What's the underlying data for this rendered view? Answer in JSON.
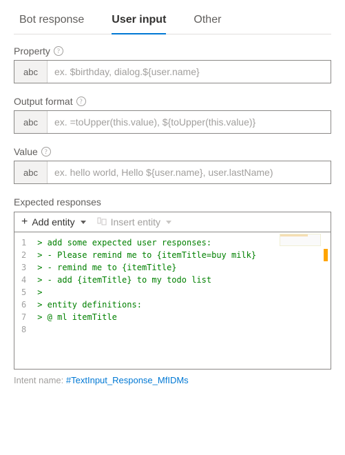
{
  "tabs": {
    "bot_response": "Bot response",
    "user_input": "User input",
    "other": "Other"
  },
  "fields": {
    "property": {
      "label": "Property",
      "prefix": "abc",
      "placeholder": "ex. $birthday, dialog.${user.name}"
    },
    "output_format": {
      "label": "Output format",
      "prefix": "abc",
      "placeholder": "ex. =toUpper(this.value), ${toUpper(this.value)}"
    },
    "value": {
      "label": "Value",
      "prefix": "abc",
      "placeholder": "ex. hello world, Hello ${user.name}, user.lastName)"
    }
  },
  "expected": {
    "label": "Expected responses",
    "add_entity": "Add entity",
    "insert_entity": "Insert entity",
    "lines": [
      "> add some expected user responses:",
      "> - Please remind me to {itemTitle=buy milk}",
      "> - remind me to {itemTitle}",
      "> - add {itemTitle} to my todo list",
      ">",
      "> entity definitions:",
      "> @ ml itemTitle",
      ""
    ]
  },
  "intent": {
    "label": "Intent name:",
    "value": "#TextInput_Response_MfIDMs"
  }
}
